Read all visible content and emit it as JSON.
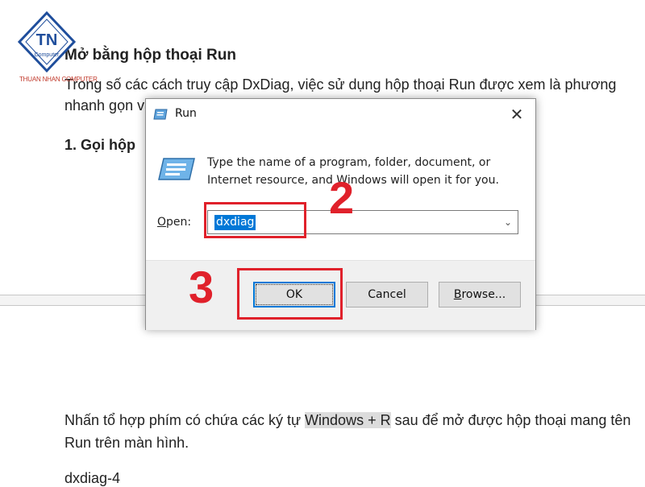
{
  "document": {
    "heading": "Mở bằng hộp thoại Run",
    "paragraph_line1": "Trong số các cách truy cập DxDiag, việc sử dụng hộp thoại Run được xem là phương",
    "paragraph_line2": "nhanh gọn và tiện ích nhất.",
    "step_heading": "1. Gọi hộp",
    "paragraph2_line1_before": "Nhấn tổ hợp phím có chứa các ký tự ",
    "paragraph2_highlight": "Windows + R",
    "paragraph2_line1_after": " sau để mở được hộp thoại mang tên",
    "paragraph2_line2": "Run trên màn hình.",
    "caption": "dxdiag-4"
  },
  "logo": {
    "text_center": "TN",
    "text_sub": "Computer",
    "caption": "THUAN NHAN COMPUTER"
  },
  "dialog": {
    "title": "Run",
    "close_symbol": "✕",
    "description_line1": "Type the name of a program, folder, document, or",
    "description_line2": "Internet resource, and Windows will open it for you.",
    "open_label_prefix": "O",
    "open_label_rest": "pen:",
    "open_value": "dxdiag",
    "combo_arrow": "⌄",
    "ok_label": "OK",
    "cancel_label": "Cancel",
    "browse_label_prefix": "B",
    "browse_label_rest": "rowse..."
  },
  "annotations": {
    "step2": "2",
    "step3": "3",
    "color": "#e0212b"
  },
  "colors": {
    "selection": "#0078d7",
    "footer_bg": "#f0f0f0",
    "highlight": "#dcdcdc"
  }
}
